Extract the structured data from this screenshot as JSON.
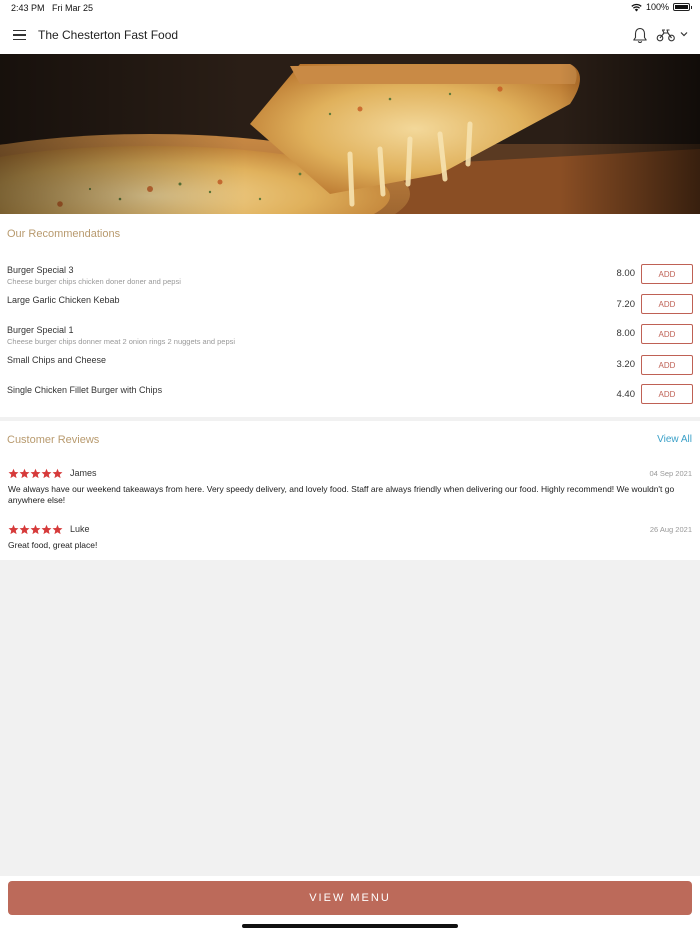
{
  "status_bar": {
    "time": "2:43 PM",
    "date": "Fri Mar 25",
    "battery": "100%"
  },
  "header": {
    "title": "The Chesterton Fast Food"
  },
  "recommendations": {
    "title": "Our Recommendations",
    "add_label": "ADD",
    "items": [
      {
        "name": "Burger Special 3",
        "desc": "Cheese burger chips chicken doner doner and pepsi",
        "price": "8.00"
      },
      {
        "name": "Large Garlic Chicken Kebab",
        "desc": "",
        "price": "7.20"
      },
      {
        "name": "Burger Special 1",
        "desc": "Cheese burger chips donner meat 2 onion rings 2 nuggets and pepsi",
        "price": "8.00"
      },
      {
        "name": "Small Chips and Cheese",
        "desc": "",
        "price": "3.20"
      },
      {
        "name": "Single Chicken Fillet Burger with Chips",
        "desc": "",
        "price": "4.40"
      }
    ]
  },
  "reviews": {
    "title": "Customer Reviews",
    "view_all": "View All",
    "items": [
      {
        "name": "James",
        "date": "04 Sep 2021",
        "rating": 5,
        "text": "We always have our weekend takeaways from here. Very speedy delivery, and lovely food. Staff are always friendly when delivering our food. Highly recommend! We wouldn't go anywhere else!"
      },
      {
        "name": "Luke",
        "date": "26 Aug 2021",
        "rating": 5,
        "text": "Great food, great place!"
      }
    ]
  },
  "footer": {
    "view_menu": "VIEW MENU"
  },
  "colors": {
    "accent": "#bc6a5a",
    "section_title": "#b89a6e",
    "link": "#3aa0c8",
    "star": "#d63a3a"
  }
}
